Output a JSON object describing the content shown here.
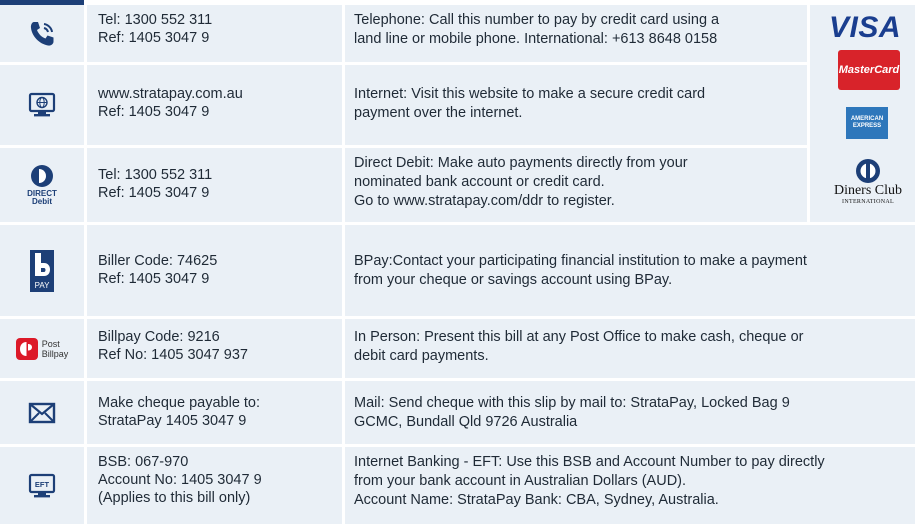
{
  "payment_methods": [
    {
      "icon": "phone-icon",
      "info": [
        "Tel: 1300 552 311",
        "Ref: 1405 3047 9"
      ],
      "description": [
        "Telephone:  Call this number to pay by credit card using a",
        "land line or mobile phone. International: +613 8648 0158"
      ]
    },
    {
      "icon": "internet-monitor-icon",
      "info": [
        "www.stratapay.com.au",
        "Ref: 1405 3047 9"
      ],
      "description": [
        "Internet:  Visit this website to make a secure credit card",
        "payment over the internet."
      ]
    },
    {
      "icon": "direct-debit-icon",
      "icon_text": [
        "DIRECT",
        "Debit"
      ],
      "info": [
        "Tel: 1300 552 311",
        "Ref: 1405 3047 9"
      ],
      "description": [
        "Direct Debit: Make auto payments directly from your",
        "nominated bank account or credit card.",
        "Go to www.stratapay.com/ddr to register."
      ]
    },
    {
      "icon": "bpay-icon",
      "icon_text": [
        "PAY"
      ],
      "info": [
        "Biller Code: 74625",
        "Ref: 1405 3047 9"
      ],
      "description": [
        "BPay:Contact your participating financial institution to make a payment",
        "from your cheque or savings account using BPay."
      ]
    },
    {
      "icon": "post-billpay-icon",
      "icon_text": [
        "Post",
        "Billpay"
      ],
      "info": [
        "Billpay Code: 9216",
        "Ref No: 1405 3047 937"
      ],
      "description": [
        "In Person:  Present this bill at any Post Office to make cash, cheque or",
        "debit card payments."
      ]
    },
    {
      "icon": "mail-envelope-icon",
      "info": [
        "Make cheque payable to:",
        "StrataPay 1405 3047 9"
      ],
      "description": [
        "Mail:  Send cheque with this slip by mail to:  StrataPay, Locked Bag 9",
        "GCMC, Bundall Qld 9726 Australia"
      ]
    },
    {
      "icon": "eft-monitor-icon",
      "icon_text": [
        "EFT"
      ],
      "info": [
        "BSB: 067-970",
        "Account No: 1405 3047 9",
        "(Applies to this bill only)"
      ],
      "description": [
        "Internet Banking - EFT:  Use this BSB and Account Number to pay directly",
        "from your bank account in Australian Dollars (AUD).",
        "Account Name: StrataPay   Bank: CBA, Sydney, Australia."
      ]
    }
  ],
  "card_logos": {
    "visa": "VISA",
    "mastercard": "MasterCard",
    "amex": [
      "AMERICAN",
      "EXPRESS"
    ],
    "diners": [
      "Diners Club",
      "INTERNATIONAL"
    ]
  },
  "colors": {
    "cell_background": "#eaf0f6",
    "icon_blue": "#1d3f77",
    "auspost_red": "#dc1928"
  }
}
